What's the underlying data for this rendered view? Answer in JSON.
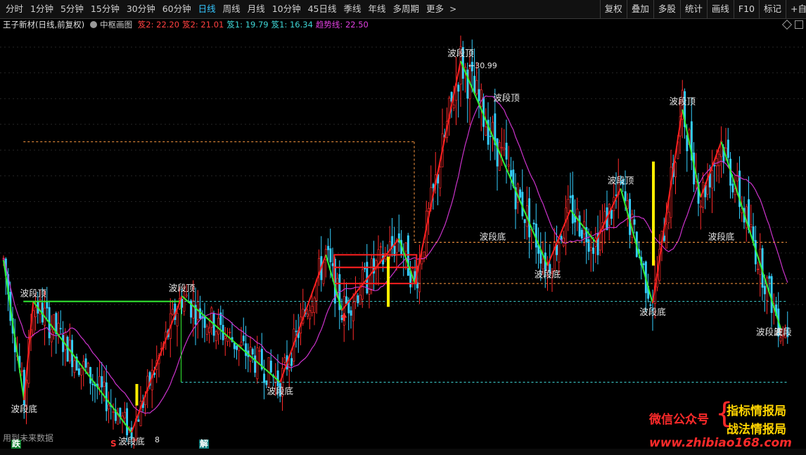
{
  "toolbar": {
    "periods": [
      "分时",
      "1分钟",
      "5分钟",
      "15分钟",
      "30分钟",
      "60分钟",
      "日线",
      "周线",
      "月线",
      "10分钟",
      "45日线",
      "季线",
      "年线",
      "多周期",
      "更多"
    ],
    "active_period": "日线",
    "more_icon": "chevron-right-icon",
    "tools": [
      "复权",
      "叠加",
      "多股",
      "统计",
      "画线",
      "F10",
      "标记",
      "+自选"
    ]
  },
  "info": {
    "stock_title": "王子新材(日线,前复权)",
    "indicator_name": "中枢画图",
    "items": [
      {
        "text": "笈2: 22.20",
        "color": "#ff4040"
      },
      {
        "text": "笈2: 21.01",
        "color": "#ff4040"
      },
      {
        "text": "笈1: 19.79",
        "color": "#3fd6d6"
      },
      {
        "text": "笈1: 16.34",
        "color": "#3fd6d6"
      },
      {
        "text": "趋势线: 22.50",
        "color": "#e040e0"
      }
    ]
  },
  "colors": {
    "up": "#ff2a2a",
    "down": "#35d0ff",
    "stroke_up": "#ff2020",
    "stroke_down": "#33ee33",
    "ma": "#cc33cc",
    "zone": "#ff2020",
    "bar": "#ffee00"
  },
  "chart_data": {
    "type": "candlestick",
    "ylim": [
      10.0,
      32.5
    ],
    "peak_label": "30.99",
    "low_label": "8",
    "stroke_points": [
      {
        "d": 0,
        "p": 19.8
      },
      {
        "d": 9,
        "p": 12.0
      },
      {
        "d": 13,
        "p": 17.5
      },
      {
        "d": 56,
        "p": 10.2
      },
      {
        "d": 78,
        "p": 17.8
      },
      {
        "d": 121,
        "p": 13.0
      },
      {
        "d": 141,
        "p": 20.1
      },
      {
        "d": 148,
        "p": 17.0
      },
      {
        "d": 173,
        "p": 21.0
      },
      {
        "d": 180,
        "p": 18.5
      },
      {
        "d": 200,
        "p": 30.9
      },
      {
        "d": 238,
        "p": 19.5
      },
      {
        "d": 248,
        "p": 22.6
      },
      {
        "d": 259,
        "p": 20.8
      },
      {
        "d": 270,
        "p": 23.8
      },
      {
        "d": 284,
        "p": 17.4
      },
      {
        "d": 297,
        "p": 28.2
      },
      {
        "d": 305,
        "p": 23.3
      },
      {
        "d": 314,
        "p": 26.4
      },
      {
        "d": 340,
        "p": 16.0
      }
    ],
    "labels": [
      {
        "text": "波段顶",
        "d": 13,
        "p": 17.5,
        "pos": "above"
      },
      {
        "text": "波段底",
        "d": 9,
        "p": 12.0,
        "pos": "below"
      },
      {
        "text": "波段底",
        "d": 56,
        "p": 10.2,
        "pos": "below"
      },
      {
        "text": "波段顶",
        "d": 78,
        "p": 17.8,
        "pos": "above"
      },
      {
        "text": "波段底",
        "d": 121,
        "p": 13.0,
        "pos": "below"
      },
      {
        "text": "波段顶",
        "d": 200,
        "p": 30.9,
        "pos": "above"
      },
      {
        "text": "波段顶",
        "d": 220,
        "p": 28.4,
        "pos": "above"
      },
      {
        "text": "波段底",
        "d": 214,
        "p": 21.6,
        "pos": "below"
      },
      {
        "text": "波段底",
        "d": 238,
        "p": 19.5,
        "pos": "below"
      },
      {
        "text": "波段顶",
        "d": 270,
        "p": 23.8,
        "pos": "above"
      },
      {
        "text": "波段底",
        "d": 284,
        "p": 17.4,
        "pos": "below"
      },
      {
        "text": "波段顶",
        "d": 297,
        "p": 28.2,
        "pos": "above"
      },
      {
        "text": "波段底",
        "d": 314,
        "p": 21.6,
        "pos": "below"
      },
      {
        "text": "波段底",
        "d": 335,
        "p": 16.3,
        "pos": "below"
      },
      {
        "text": "波段",
        "d": 341,
        "p": 16.3,
        "pos": "below"
      }
    ],
    "zones": [
      {
        "d1": 145,
        "d2": 181,
        "top": 20.1,
        "bottom": 18.5
      },
      {
        "d1": 145,
        "d2": 181,
        "top": 19.4,
        "bottom": 19.4
      }
    ],
    "ref_lines": [
      {
        "color": "#ff9a40",
        "d1": 9,
        "d2": 180,
        "p": 26.4,
        "style": "dashed"
      },
      {
        "color": "#ff9a40",
        "d1": 180,
        "d2": 343,
        "p": 20.8,
        "style": "dashed"
      },
      {
        "color": "#ff9a40",
        "d1": 180,
        "d2": 343,
        "p": 18.5,
        "style": "dashed"
      },
      {
        "color": "#3fd6d6",
        "d1": 13,
        "d2": 343,
        "p": 17.5,
        "style": "dashed"
      },
      {
        "color": "#3fd6d6",
        "d1": 78,
        "d2": 343,
        "p": 13.0,
        "style": "dashed"
      },
      {
        "color": "#33ee33",
        "d1": 9,
        "d2": 78,
        "p": 17.5,
        "style": "solid"
      }
    ],
    "yellow_bars": [
      {
        "d": 58,
        "top": 12.9,
        "bottom": 11.7
      },
      {
        "d": 168,
        "top": 20.0,
        "bottom": 17.2
      },
      {
        "d": 284,
        "top": 25.3,
        "bottom": 19.5
      }
    ],
    "buy_arrow": {
      "d": 149,
      "p": 16.6
    }
  },
  "watermark": {
    "account_label": "微信公众号",
    "line1": "指标情报局",
    "line2": "战法情报局",
    "url": "www.zhibiao168.com"
  },
  "footer": {
    "future_note": "用到未来数据",
    "signals": [
      "跌",
      "S",
      "解"
    ]
  }
}
